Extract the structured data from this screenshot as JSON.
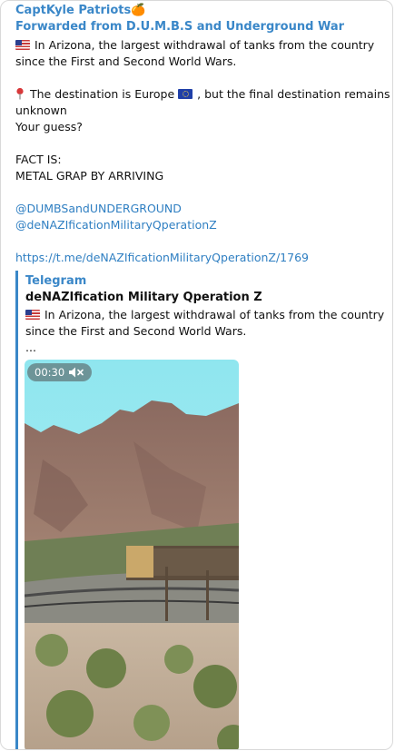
{
  "message": {
    "sender": "CaptKyle Patriots🍊",
    "forwarded_from": "Forwarded from D.U.M.B.S and Underground War",
    "lines": [
      "In Arizona, the largest withdrawal of tanks from the country",
      "since the First and Second World Wars.",
      "The destination is Europe",
      ", but the final destination remains",
      "unknown",
      "Your guess?",
      "FACT IS:",
      "METAL GRAP BY ARRIVING"
    ],
    "mentions": [
      "@DUMBSandUNDERGROUND",
      "@deNAZIficationMilitaryQperationZ"
    ],
    "link": "https://t.me/deNAZIficationMilitaryQperationZ/1769"
  },
  "preview": {
    "source": "Telegram",
    "title": "deNAZIfication Military Qperation Z",
    "lines": [
      "In Arizona, the largest withdrawal of tanks from the country",
      "since the First and Second World Wars.",
      "..."
    ],
    "video": {
      "duration": "00:30",
      "muted_icon": "speaker-muted-icon"
    }
  },
  "colors": {
    "accent": "#3a87c8",
    "link": "#2f7fc2",
    "text": "#111111"
  }
}
